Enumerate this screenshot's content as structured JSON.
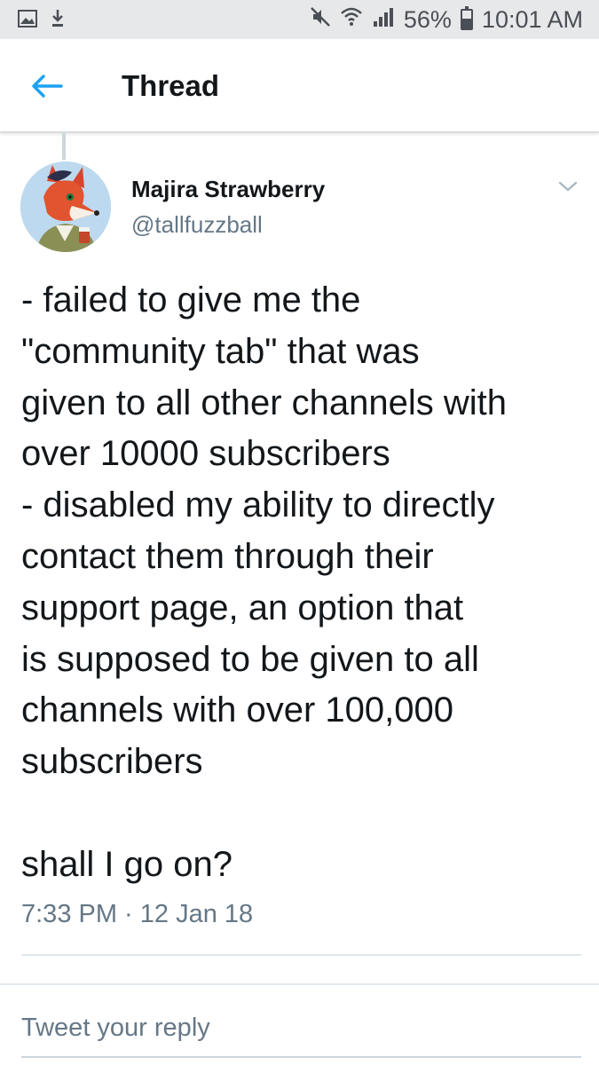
{
  "status_bar": {
    "battery_percent": "56%",
    "time": "10:01 AM",
    "left_icons": [
      "image-icon",
      "download-icon"
    ],
    "right_icons": [
      "mute-icon",
      "wifi-icon",
      "signal-icon",
      "battery-icon"
    ]
  },
  "header": {
    "title": "Thread",
    "back_icon": "arrow-left-icon"
  },
  "tweet": {
    "author_name": "Majira Strawberry",
    "author_handle": "@tallfuzzball",
    "text": "- failed to give me the\n\"community tab\" that was\ngiven to all other channels with\nover 10000 subscribers\n- disabled my ability to directly\ncontact them through their\nsupport page, an option that\nis supposed to be given to all\nchannels with over 100,000\nsubscribers\n\nshall I go on?",
    "timestamp": "7:33 PM · 12 Jan 18"
  },
  "reply": {
    "placeholder": "Tweet your reply"
  },
  "colors": {
    "accent": "#1da1f2",
    "text_primary": "#14171a",
    "text_secondary": "#657786",
    "status_bar_bg": "#e7e8ea"
  }
}
